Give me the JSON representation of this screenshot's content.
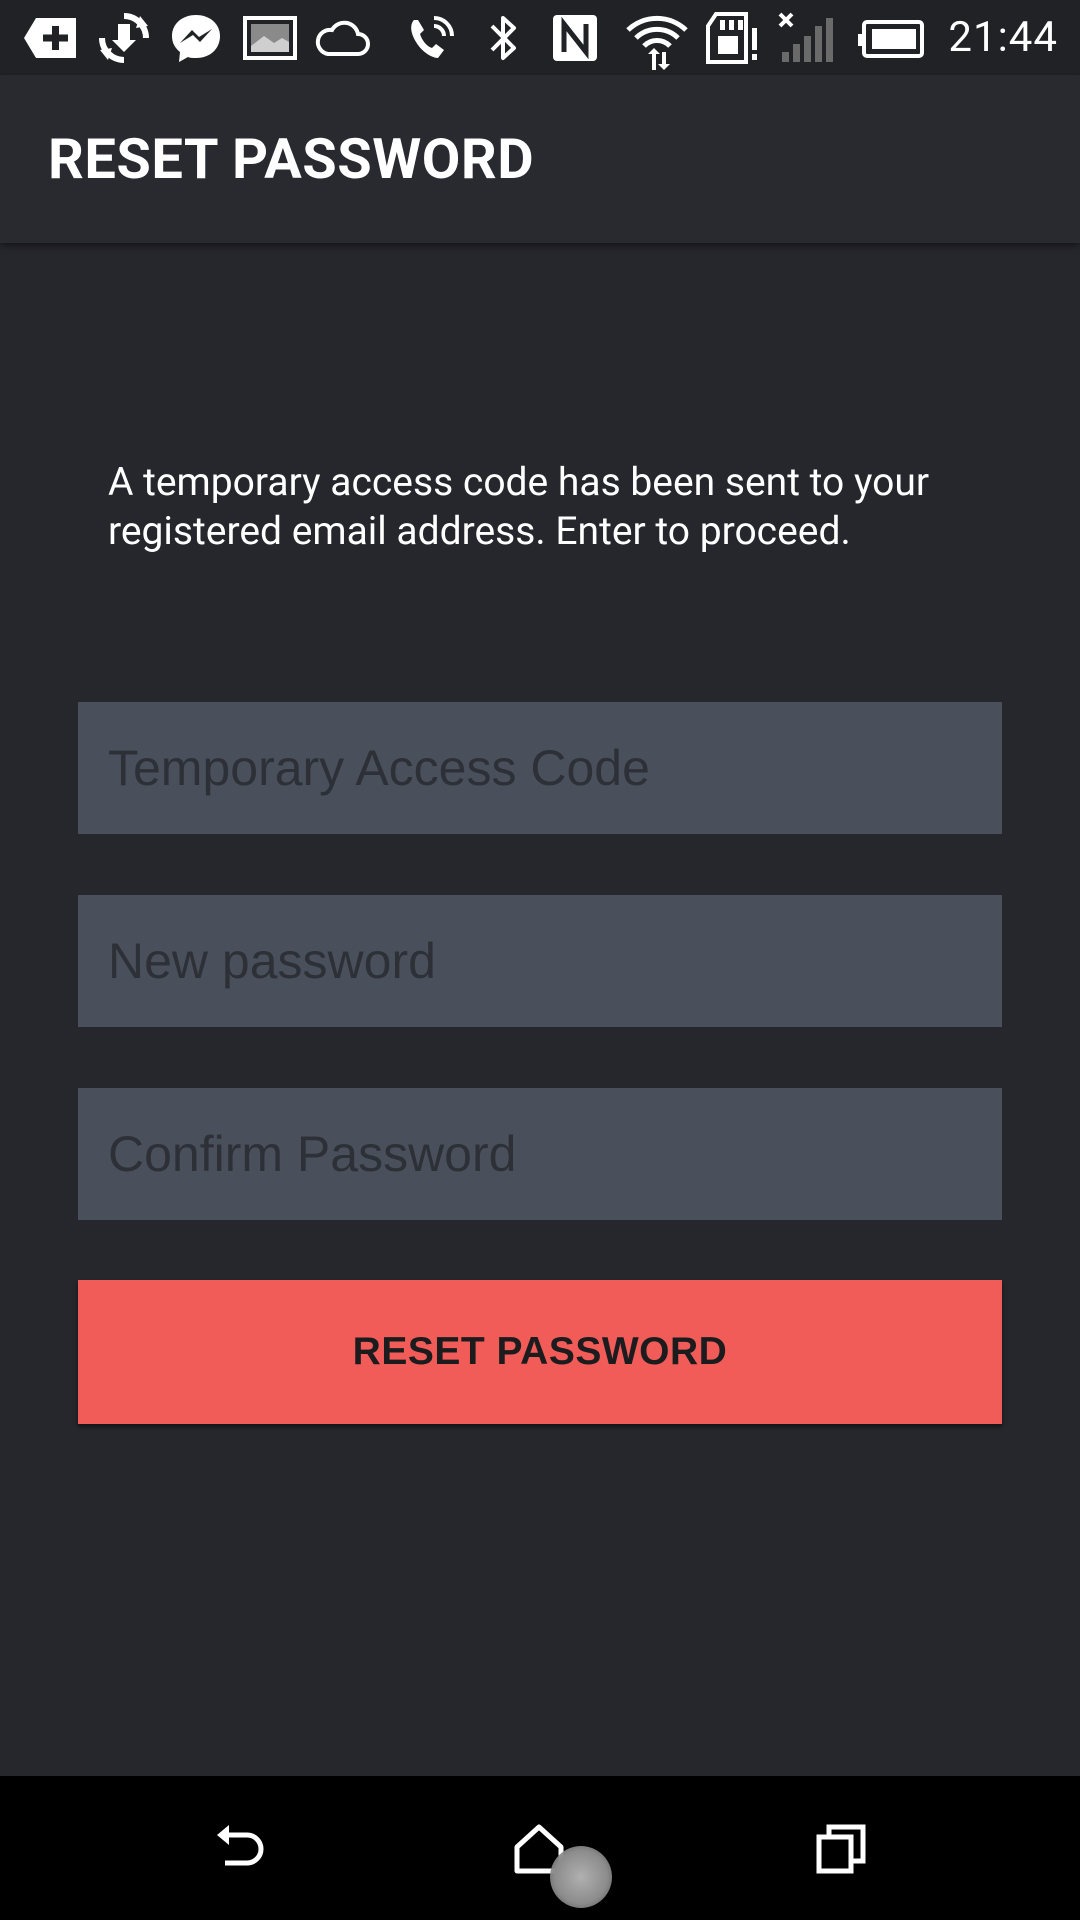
{
  "status_bar": {
    "time": "21:44",
    "icons": [
      "add-icon",
      "sync-icon",
      "messenger-icon",
      "image-icon",
      "cloud-icon",
      "call-forward-icon",
      "bluetooth-icon",
      "nfc-icon",
      "wifi-icon",
      "sd-card-alert-icon",
      "signal-icon",
      "battery-icon"
    ]
  },
  "app_bar": {
    "title": "RESET PASSWORD"
  },
  "content": {
    "message": "A temporary access code has been sent to your registered email address. Enter to proceed.",
    "fields": {
      "access_code": {
        "placeholder": "Temporary Access Code",
        "value": ""
      },
      "new_password": {
        "placeholder": "New password",
        "value": ""
      },
      "confirm_password": {
        "placeholder": "Confirm Password",
        "value": ""
      }
    },
    "submit_label": "RESET PASSWORD"
  },
  "nav_bar": {
    "icons": [
      "back-icon",
      "home-icon",
      "recents-icon"
    ]
  },
  "colors": {
    "background": "#25272c",
    "app_bar": "#282a30",
    "field": "#4a505b",
    "accent": "#f25c58"
  }
}
